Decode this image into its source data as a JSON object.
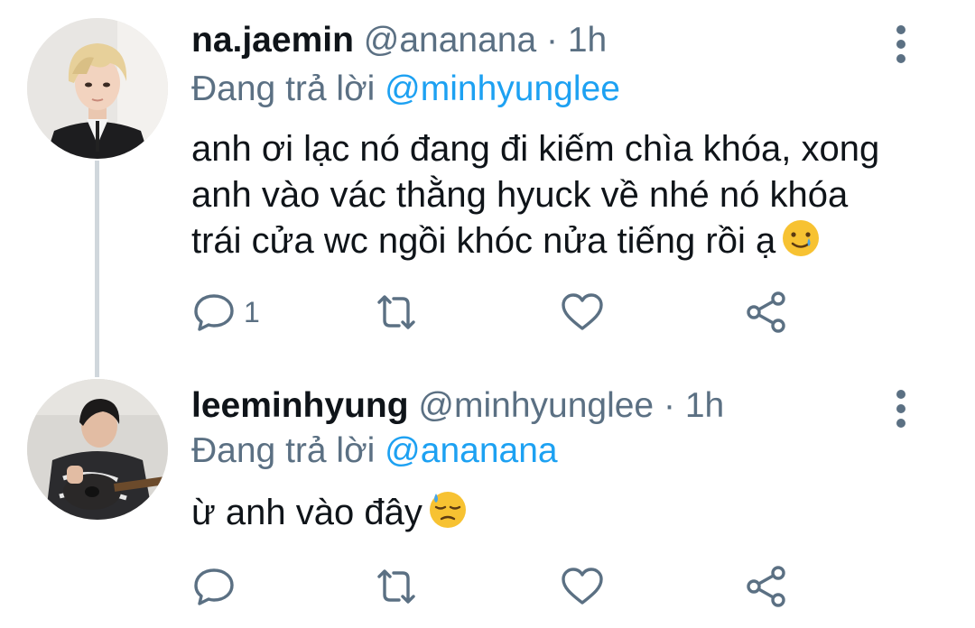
{
  "tweets": [
    {
      "display_name": "na.jaemin",
      "handle": "@ananana",
      "separator": "·",
      "time": "1h",
      "reply_prefix": "Đang trả lời",
      "reply_to": "@minhyunglee",
      "body_lines": [
        "anh ơi lạc nó đang đi kiếm chìa khóa, xong",
        "anh vào vác thằng hyuck về nhé nó khóa",
        "trái cửa wc ngồi khóc nửa tiếng rồi ạ"
      ],
      "emoji": "smiling-face-with-tear",
      "reply_count": "1"
    },
    {
      "display_name": "leeminhyung",
      "handle": "@minhyunglee",
      "separator": "·",
      "time": "1h",
      "reply_prefix": "Đang trả lời",
      "reply_to": "@ananana",
      "body_lines": [
        "ừ anh vào đây"
      ],
      "emoji": "downcast-face-with-sweat",
      "reply_count": ""
    }
  ],
  "colors": {
    "text": "#0f1419",
    "secondary": "#5b7083",
    "link": "#1da1f2",
    "thread_line": "#d0d7dc"
  }
}
